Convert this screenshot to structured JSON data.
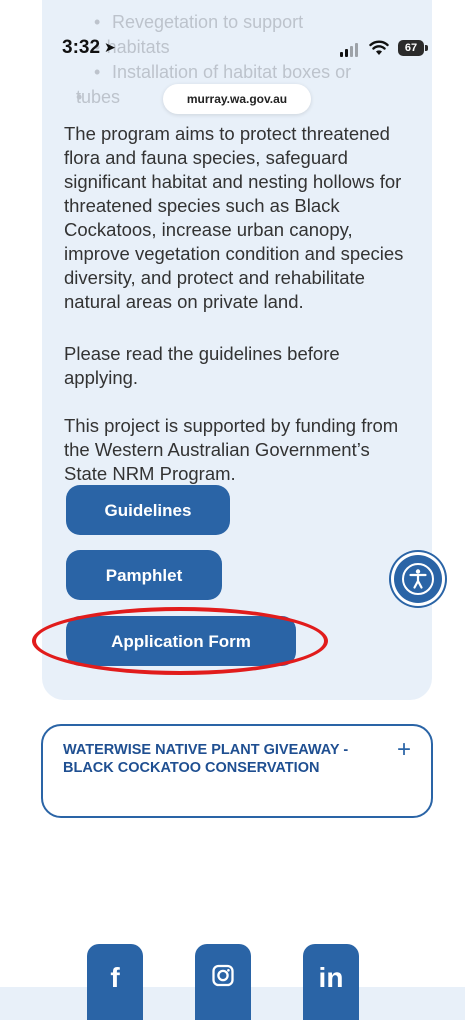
{
  "top_bullets": [
    "Revegetation to support",
    "habitats",
    "Installation of habitat boxes or",
    "tubes"
  ],
  "status_bar": {
    "time": "3:32",
    "battery": "67"
  },
  "url": "murray.wa.gov.au",
  "content": {
    "paragraph1": "The program aims to protect threatened flora and fauna species, safeguard significant habitat and nesting hollows for threatened species such as Black Cockatoos, increase urban canopy, improve vegetation condition and species diversity, and protect and rehabilitate natural areas on private land.",
    "paragraph2": "Please read the guidelines before applying.",
    "paragraph3": "This project is supported by funding from the Western Australian Government’s State NRM Program."
  },
  "buttons": {
    "guidelines": "Guidelines",
    "pamphlet": "Pamphlet",
    "application_form": "Application Form"
  },
  "accordion": {
    "title": "WATERWISE NATIVE PLANT GIVEAWAY - BLACK COCKATOO CONSERVATION",
    "toggle": "+"
  },
  "social": {
    "facebook": "f",
    "instagram": "instagram-icon",
    "linkedin": "in"
  },
  "colors": {
    "accent": "#2a64a6",
    "card_bg": "#e8f0f9",
    "highlight": "#e11c1c"
  }
}
